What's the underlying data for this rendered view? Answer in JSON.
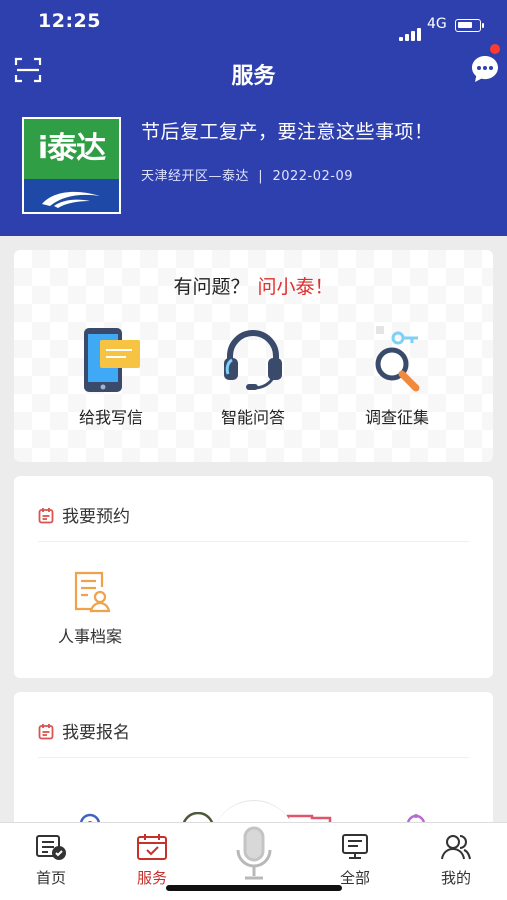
{
  "status_bar": {
    "time": "12:25",
    "network": "4G",
    "battery_level": 0.7
  },
  "header": {
    "title": "服务"
  },
  "news": {
    "logo_text": "i泰达",
    "title": "节后复工复产，要注意这些事项！",
    "source": "天津经开区—泰达",
    "date": "2022-02-09"
  },
  "ask": {
    "prefix": "有问题？",
    "highlight": "问小泰！",
    "services": [
      {
        "label": "给我写信",
        "icon": "letter-phone-icon"
      },
      {
        "label": "智能问答",
        "icon": "headset-icon"
      },
      {
        "label": "调查征集",
        "icon": "magnifier-survey-icon"
      }
    ]
  },
  "booking": {
    "title": "我要预约",
    "items": [
      {
        "label": "人事档案",
        "icon": "personnel-file-icon"
      }
    ]
  },
  "signup": {
    "title": "我要报名"
  },
  "tabs": [
    {
      "label": "首页",
      "icon": "home-doc-icon"
    },
    {
      "label": "服务",
      "icon": "service-calendar-icon",
      "active": true
    },
    {
      "label": "",
      "icon": "microphone-icon"
    },
    {
      "label": "全部",
      "icon": "monitor-icon"
    },
    {
      "label": "我的",
      "icon": "user-icon"
    }
  ],
  "colors": {
    "brand_blue": "#2e3fae",
    "accent_red": "#e02d2d",
    "tab_active": "#c8302b"
  }
}
